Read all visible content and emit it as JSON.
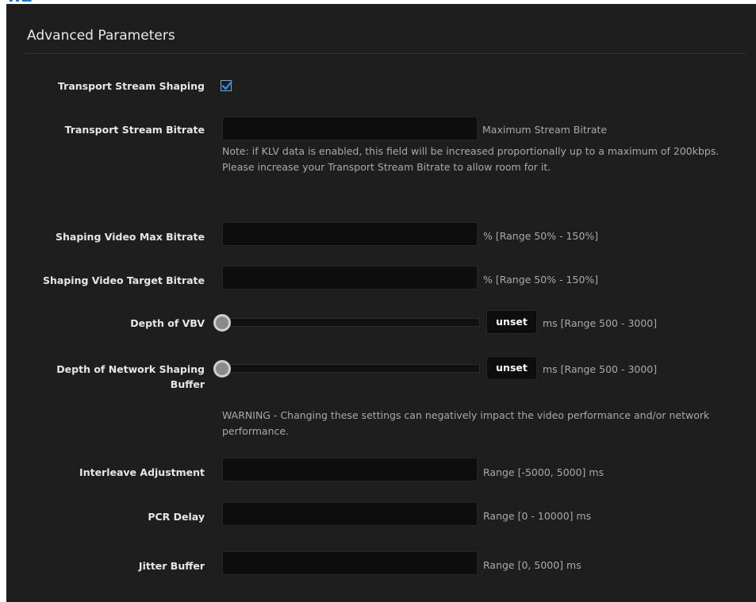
{
  "panel": {
    "title": "Advanced Parameters"
  },
  "fields": {
    "ts_shaping": {
      "label": "Transport Stream Shaping",
      "checked": true
    },
    "ts_bitrate": {
      "label": "Transport Stream Bitrate",
      "value": "",
      "hint": "Maximum Stream Bitrate",
      "note": "Note: if KLV data is enabled, this field will be increased proportionally up to a maximum of 200kbps. Please increase your Transport Stream Bitrate to allow room for it."
    },
    "video_max": {
      "label": "Shaping Video Max Bitrate",
      "value": "",
      "hint": "% [Range 50% - 150%]"
    },
    "video_target": {
      "label": "Shaping Video Target Bitrate",
      "value": "",
      "hint": "% [Range 50% - 150%]"
    },
    "vbv": {
      "label": "Depth of VBV",
      "slider_fraction": 0,
      "readout": "unset",
      "hint": "ms [Range 500 - 3000]"
    },
    "net_buffer": {
      "label_line1": "Depth of Network Shaping",
      "label_line2": "Buffer",
      "slider_fraction": 0,
      "readout": "unset",
      "hint": "ms [Range 500 - 3000]",
      "warning": "WARNING - Changing these settings can negatively impact the video performance and/or network performance."
    },
    "interleave": {
      "label": "Interleave Adjustment",
      "value": "",
      "hint": "Range [-5000, 5000] ms"
    },
    "pcr_delay": {
      "label": "PCR Delay",
      "value": "",
      "hint": "Range [0 - 10000] ms"
    },
    "jitter": {
      "label": "Jitter Buffer",
      "value": "",
      "hint": "Range [0, 5000] ms"
    }
  },
  "colors": {
    "panel_bg": "#1e1e1e",
    "input_bg": "#0d0d0d",
    "accent": "#1a73c8"
  },
  "icons": {
    "checkbox": "checkmark-icon",
    "slider": "slider-thumb-icon"
  }
}
